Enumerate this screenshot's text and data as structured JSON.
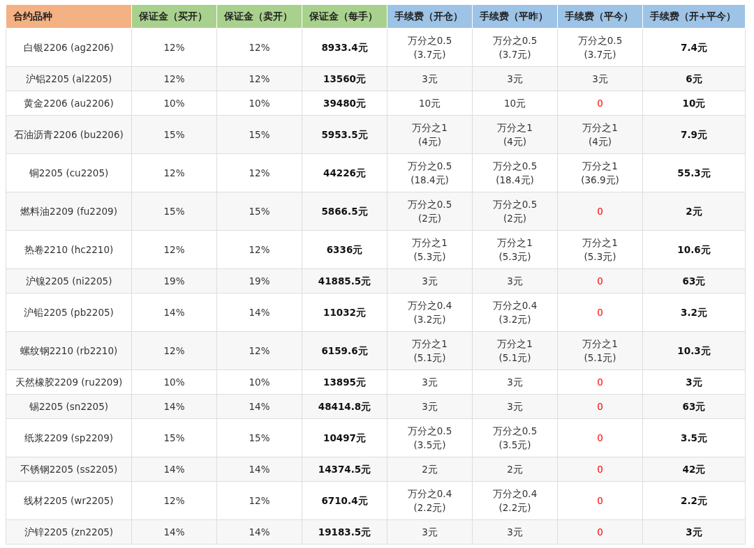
{
  "table": {
    "columns": [
      {
        "label": "合约品种",
        "color": "#f4b183"
      },
      {
        "label": "保证金（买开）",
        "color": "#a9d18e"
      },
      {
        "label": "保证金（卖开）",
        "color": "#a9d18e"
      },
      {
        "label": "保证金（每手）",
        "color": "#a9d18e"
      },
      {
        "label": "手续费（开仓）",
        "color": "#9dc3e6"
      },
      {
        "label": "手续费（平昨）",
        "color": "#9dc3e6"
      },
      {
        "label": "手续费（平今）",
        "color": "#9dc3e6"
      },
      {
        "label": "手续费（开+平今）",
        "color": "#9dc3e6"
      }
    ],
    "rows": [
      {
        "name": "白银2206 (ag2206)",
        "buy": "12%",
        "sell": "12%",
        "per_lot": "8933.4元",
        "fees": [
          {
            "kind": "rate",
            "rate": "万分之0.5",
            "amount": "(3.7元)"
          },
          {
            "kind": "rate",
            "rate": "万分之0.5",
            "amount": "(3.7元)"
          },
          {
            "kind": "rate",
            "rate": "万分之0.5",
            "amount": "(3.7元)"
          }
        ],
        "total": "7.4元"
      },
      {
        "name": "沪铝2205 (al2205)",
        "buy": "12%",
        "sell": "12%",
        "per_lot": "13560元",
        "fees": [
          {
            "kind": "fixed",
            "rate": "3元"
          },
          {
            "kind": "fixed",
            "rate": "3元"
          },
          {
            "kind": "fixed",
            "rate": "3元"
          }
        ],
        "total": "6元"
      },
      {
        "name": "黄金2206 (au2206)",
        "buy": "10%",
        "sell": "10%",
        "per_lot": "39480元",
        "fees": [
          {
            "kind": "fixed",
            "rate": "10元"
          },
          {
            "kind": "fixed",
            "rate": "10元"
          },
          {
            "kind": "zero",
            "rate": "0"
          }
        ],
        "total": "10元"
      },
      {
        "name": "石油沥青2206 (bu2206)",
        "buy": "15%",
        "sell": "15%",
        "per_lot": "5953.5元",
        "fees": [
          {
            "kind": "rate",
            "rate": "万分之1",
            "amount": "(4元)"
          },
          {
            "kind": "rate",
            "rate": "万分之1",
            "amount": "(4元)"
          },
          {
            "kind": "rate",
            "rate": "万分之1",
            "amount": "(4元)"
          }
        ],
        "total": "7.9元"
      },
      {
        "name": "铜2205 (cu2205)",
        "buy": "12%",
        "sell": "12%",
        "per_lot": "44226元",
        "fees": [
          {
            "kind": "rate",
            "rate": "万分之0.5",
            "amount": "(18.4元)"
          },
          {
            "kind": "rate",
            "rate": "万分之0.5",
            "amount": "(18.4元)"
          },
          {
            "kind": "rate",
            "rate": "万分之1",
            "amount": "(36.9元)"
          }
        ],
        "total": "55.3元"
      },
      {
        "name": "燃料油2209 (fu2209)",
        "buy": "15%",
        "sell": "15%",
        "per_lot": "5866.5元",
        "fees": [
          {
            "kind": "rate",
            "rate": "万分之0.5",
            "amount": "(2元)"
          },
          {
            "kind": "rate",
            "rate": "万分之0.5",
            "amount": "(2元)"
          },
          {
            "kind": "zero",
            "rate": "0"
          }
        ],
        "total": "2元"
      },
      {
        "name": "热卷2210 (hc2210)",
        "buy": "12%",
        "sell": "12%",
        "per_lot": "6336元",
        "fees": [
          {
            "kind": "rate",
            "rate": "万分之1",
            "amount": "(5.3元)"
          },
          {
            "kind": "rate",
            "rate": "万分之1",
            "amount": "(5.3元)"
          },
          {
            "kind": "rate",
            "rate": "万分之1",
            "amount": "(5.3元)"
          }
        ],
        "total": "10.6元"
      },
      {
        "name": "沪镍2205 (ni2205)",
        "buy": "19%",
        "sell": "19%",
        "per_lot": "41885.5元",
        "fees": [
          {
            "kind": "fixed",
            "rate": "3元"
          },
          {
            "kind": "fixed",
            "rate": "3元"
          },
          {
            "kind": "zero",
            "rate": "0"
          }
        ],
        "total": "63元"
      },
      {
        "name": "沪铅2205 (pb2205)",
        "buy": "14%",
        "sell": "14%",
        "per_lot": "11032元",
        "fees": [
          {
            "kind": "rate",
            "rate": "万分之0.4",
            "amount": "(3.2元)"
          },
          {
            "kind": "rate",
            "rate": "万分之0.4",
            "amount": "(3.2元)"
          },
          {
            "kind": "zero",
            "rate": "0"
          }
        ],
        "total": "3.2元"
      },
      {
        "name": "螺纹钢2210 (rb2210)",
        "buy": "12%",
        "sell": "12%",
        "per_lot": "6159.6元",
        "fees": [
          {
            "kind": "rate",
            "rate": "万分之1",
            "amount": "(5.1元)"
          },
          {
            "kind": "rate",
            "rate": "万分之1",
            "amount": "(5.1元)"
          },
          {
            "kind": "rate",
            "rate": "万分之1",
            "amount": "(5.1元)"
          }
        ],
        "total": "10.3元"
      },
      {
        "name": "天然橡胶2209 (ru2209)",
        "buy": "10%",
        "sell": "10%",
        "per_lot": "13895元",
        "fees": [
          {
            "kind": "fixed",
            "rate": "3元"
          },
          {
            "kind": "fixed",
            "rate": "3元"
          },
          {
            "kind": "zero",
            "rate": "0"
          }
        ],
        "total": "3元"
      },
      {
        "name": "锡2205 (sn2205)",
        "buy": "14%",
        "sell": "14%",
        "per_lot": "48414.8元",
        "fees": [
          {
            "kind": "fixed",
            "rate": "3元"
          },
          {
            "kind": "fixed",
            "rate": "3元"
          },
          {
            "kind": "zero",
            "rate": "0"
          }
        ],
        "total": "63元"
      },
      {
        "name": "纸浆2209 (sp2209)",
        "buy": "15%",
        "sell": "15%",
        "per_lot": "10497元",
        "fees": [
          {
            "kind": "rate",
            "rate": "万分之0.5",
            "amount": "(3.5元)"
          },
          {
            "kind": "rate",
            "rate": "万分之0.5",
            "amount": "(3.5元)"
          },
          {
            "kind": "zero",
            "rate": "0"
          }
        ],
        "total": "3.5元"
      },
      {
        "name": "不锈钢2205 (ss2205)",
        "buy": "14%",
        "sell": "14%",
        "per_lot": "14374.5元",
        "fees": [
          {
            "kind": "fixed",
            "rate": "2元"
          },
          {
            "kind": "fixed",
            "rate": "2元"
          },
          {
            "kind": "zero",
            "rate": "0"
          }
        ],
        "total": "42元"
      },
      {
        "name": "线材2205 (wr2205)",
        "buy": "12%",
        "sell": "12%",
        "per_lot": "6710.4元",
        "fees": [
          {
            "kind": "rate",
            "rate": "万分之0.4",
            "amount": "(2.2元)"
          },
          {
            "kind": "rate",
            "rate": "万分之0.4",
            "amount": "(2.2元)"
          },
          {
            "kind": "zero",
            "rate": "0"
          }
        ],
        "total": "2.2元"
      },
      {
        "name": "沪锌2205 (zn2205)",
        "buy": "14%",
        "sell": "14%",
        "per_lot": "19183.5元",
        "fees": [
          {
            "kind": "fixed",
            "rate": "3元"
          },
          {
            "kind": "fixed",
            "rate": "3元"
          },
          {
            "kind": "zero",
            "rate": "0"
          }
        ],
        "total": "3元"
      }
    ]
  }
}
